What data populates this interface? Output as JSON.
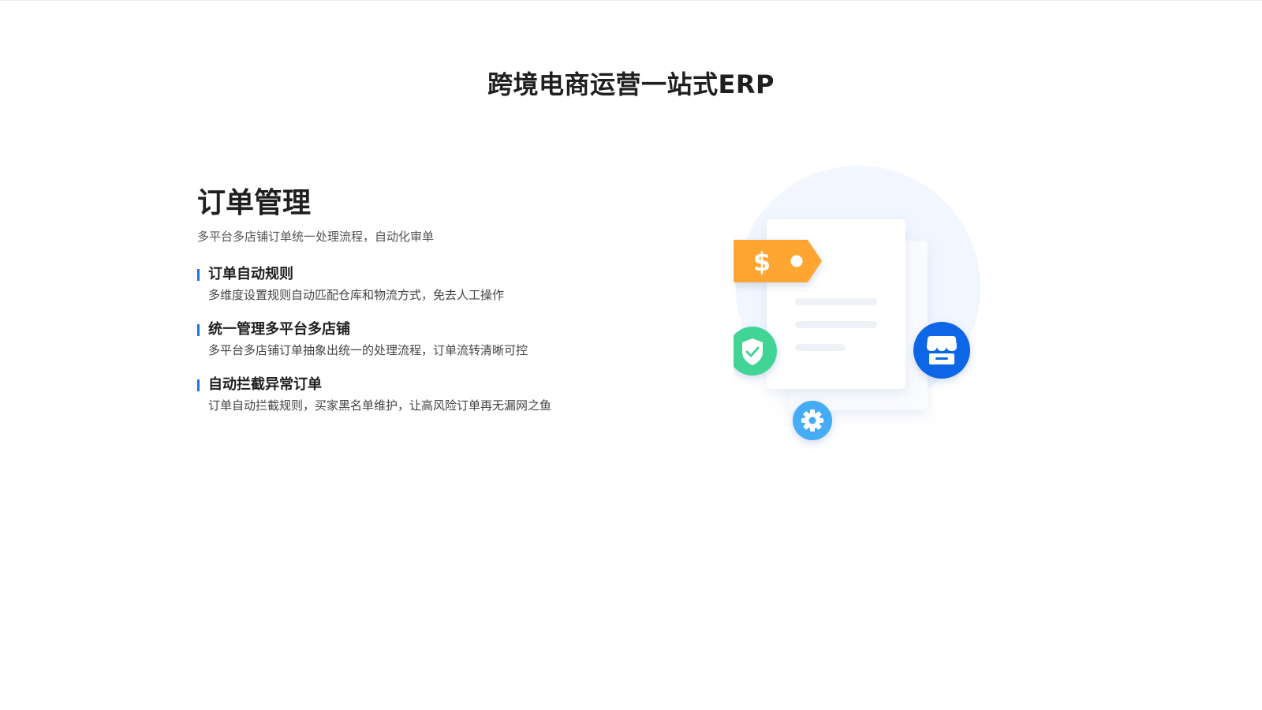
{
  "section": {
    "title": "跨境电商运营一站式ERP"
  },
  "order_management": {
    "title": "订单管理",
    "subtitle": "多平台多店铺订单统一处理流程，自动化审单",
    "features": [
      {
        "title": "订单自动规则",
        "desc": "多维度设置规则自动匹配仓库和物流方式，免去人工操作"
      },
      {
        "title": "统一管理多平台多店铺",
        "desc": "多平台多店铺订单抽象出统一的处理流程，订单流转清晰可控"
      },
      {
        "title": "自动拦截异常订单",
        "desc": "订单自动拦截规则，买家黑名单维护，让高风险订单再无漏网之鱼"
      }
    ]
  },
  "illustration": {
    "price_tag_symbol": "$",
    "icons": [
      "document-icon",
      "price-tag-icon",
      "shield-check-icon",
      "store-icon",
      "gear-icon"
    ],
    "colors": {
      "accent": "#1a73e8",
      "tag": "#ffa533",
      "shield": "#3fd495",
      "store": "#0d66e6",
      "gear": "#45acf5",
      "halo": "#eef4ff"
    }
  }
}
